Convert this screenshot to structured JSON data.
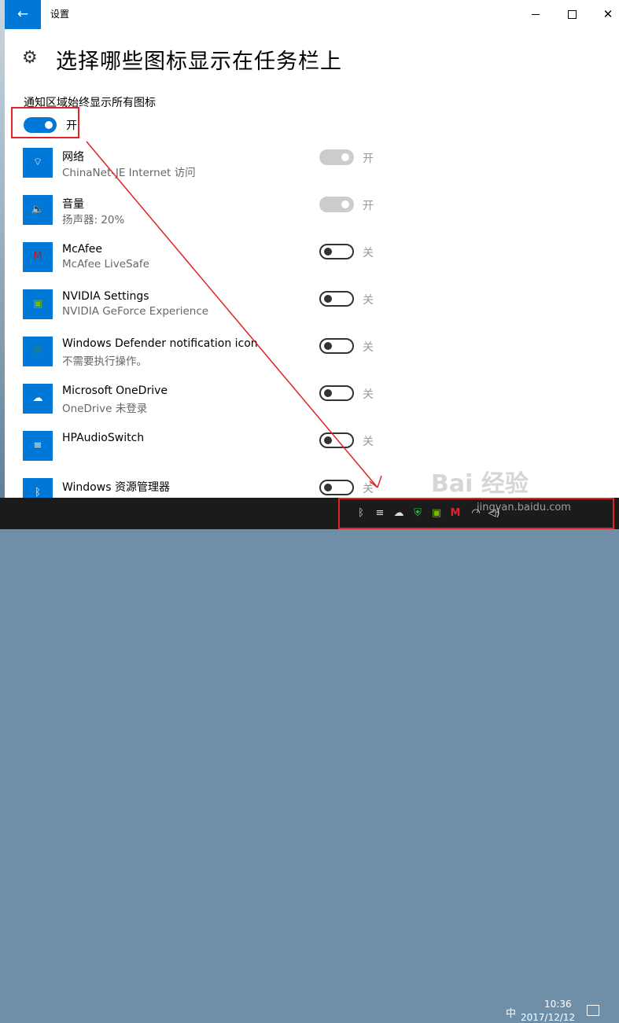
{
  "window": {
    "title": "设置",
    "back_glyph": "←",
    "close_glyph": "✕"
  },
  "header": {
    "title": "选择哪些图标显示在任务栏上",
    "icon": "gear-icon"
  },
  "master": {
    "label": "通知区域始终显示所有图标",
    "state": "开",
    "on": true
  },
  "items": [
    {
      "name": "网络",
      "desc": "ChinaNet-JE Internet 访问",
      "state": "开",
      "toggle": "on-disabled",
      "icon": "wifi-icon",
      "glyph": "⌔"
    },
    {
      "name": "音量",
      "desc": "扬声器: 20%",
      "state": "开",
      "toggle": "on-disabled",
      "icon": "speaker-icon",
      "glyph": "🔈"
    },
    {
      "name": "McAfee",
      "desc": "McAfee LiveSafe",
      "state": "关",
      "toggle": "off",
      "icon": "mcafee-icon",
      "glyph": "M"
    },
    {
      "name": "NVIDIA Settings",
      "desc": "NVIDIA GeForce Experience",
      "state": "关",
      "toggle": "off",
      "icon": "nvidia-icon",
      "glyph": "▣"
    },
    {
      "name": "Windows Defender notification icon",
      "desc": "不需要执行操作。",
      "state": "关",
      "toggle": "off",
      "icon": "shield-icon",
      "glyph": "⛨"
    },
    {
      "name": "Microsoft OneDrive",
      "desc": "OneDrive 未登录",
      "state": "关",
      "toggle": "off",
      "icon": "cloud-icon",
      "glyph": "☁"
    },
    {
      "name": "HPAudioSwitch",
      "desc": "",
      "state": "关",
      "toggle": "off",
      "icon": "audio-switch-icon",
      "glyph": "≡"
    },
    {
      "name": "Windows 资源管理器",
      "desc": "",
      "state": "关",
      "toggle": "off",
      "icon": "bluetooth-icon",
      "glyph": "ᛒ"
    }
  ],
  "taskbar": {
    "time": "10:36",
    "date": "2017/12/12",
    "ime": "中",
    "tray_icons": [
      "bluetooth-icon",
      "audio-switch-icon",
      "cloud-icon",
      "shield-icon",
      "nvidia-icon",
      "mcafee-icon",
      "wifi-icon",
      "speaker-icon"
    ]
  },
  "watermark": {
    "brand": "Bai 经验",
    "url": "jingyan.baidu.com"
  },
  "colors": {
    "accent": "#0078d7",
    "annotation": "#e0232a"
  }
}
